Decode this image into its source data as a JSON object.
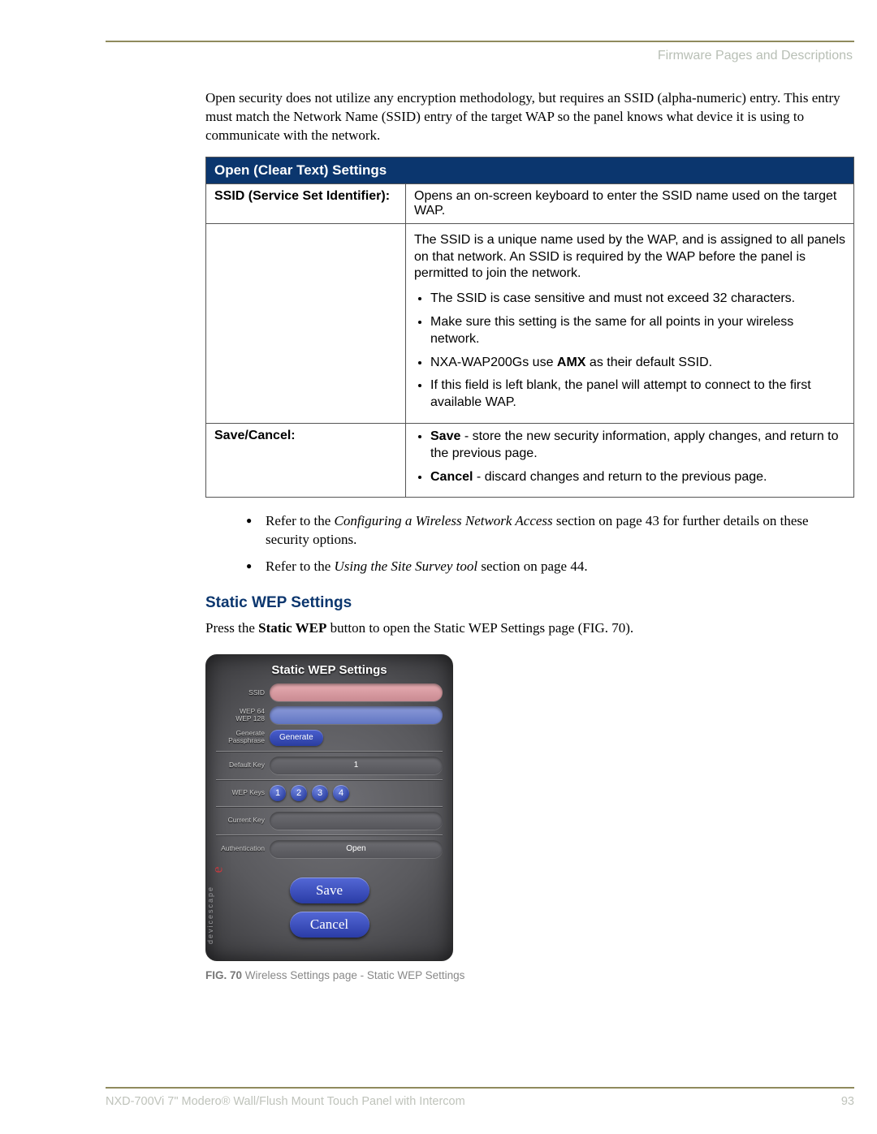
{
  "header": "Firmware Pages and Descriptions",
  "intro": "Open security does not utilize any encryption methodology, but requires an SSID (alpha-numeric) entry. This entry must match the Network Name (SSID) entry of the target WAP so the panel knows what device it is using to communicate with the network.",
  "table": {
    "title": "Open (Clear Text) Settings",
    "row1": {
      "label": "SSID (Service Set Identifier):",
      "p1": "Opens an on-screen keyboard to enter the SSID name used on the target WAP.",
      "p2": "The SSID is a unique name used by the WAP, and is assigned to all panels on that network. An SSID is required by the WAP before the panel is permitted to join the network.",
      "b1": "The SSID is case sensitive and must not exceed 32 characters.",
      "b2": "Make sure this setting is the same for all points in your wireless network.",
      "b3a": "NXA-WAP200Gs use ",
      "b3b": "AMX",
      "b3c": " as their default SSID.",
      "b4": "If this field is left blank, the panel will attempt to connect to the first available WAP."
    },
    "row2": {
      "label": "Save/Cancel:",
      "s1a": "Save",
      "s1b": " - store the new security information, apply changes, and return to the previous page.",
      "s2a": "Cancel",
      "s2b": " - discard changes and return to the previous page."
    }
  },
  "refs": {
    "r1a": "Refer to the ",
    "r1b": "Configuring a Wireless Network Access",
    "r1c": " section on page 43 for further details on these security options.",
    "r2a": "Refer to the ",
    "r2b": "Using the Site Survey tool",
    "r2c": " section on page 44."
  },
  "wep": {
    "heading": "Static WEP Settings",
    "body_a": "Press the ",
    "body_b": "Static WEP",
    "body_c": " button to open the Static WEP Settings page (FIG. 70)."
  },
  "device": {
    "title": "Static WEP Settings",
    "labels": {
      "ssid": "SSID",
      "wep64": "WEP 64\nWEP 128",
      "gen": "Generate\nPassphrase",
      "genbtn": "Generate",
      "defkey": "Default Key",
      "defval": "1",
      "wepkeys": "WEP Keys",
      "keys": [
        "1",
        "2",
        "3",
        "4"
      ],
      "curkey": "Current Key",
      "auth": "Authentication",
      "authval": "Open",
      "save": "Save",
      "cancel": "Cancel"
    },
    "brand": "devicescape",
    "brand_e": "e"
  },
  "caption": {
    "a": "FIG. 70",
    "b": "  Wireless Settings page - Static WEP Settings"
  },
  "footer": {
    "product": "NXD-700Vi 7\" Modero® Wall/Flush Mount Touch Panel with Intercom",
    "page": "93"
  }
}
